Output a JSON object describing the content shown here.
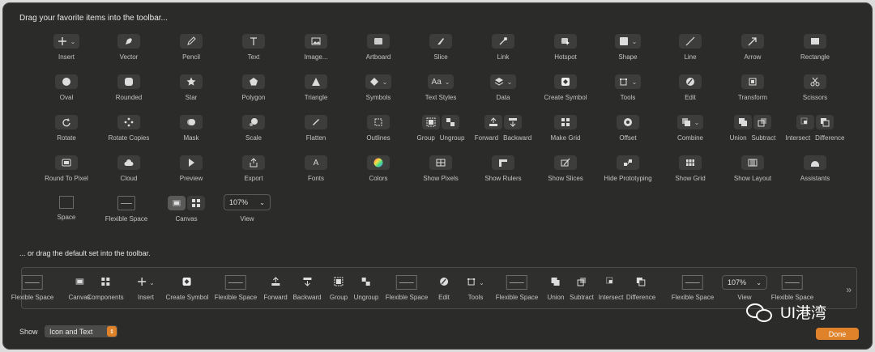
{
  "title": "Drag your favorite items into the toolbar...",
  "rows": [
    [
      {
        "label": "Insert",
        "icon": "plus-icon",
        "chev": true
      },
      {
        "label": "Vector",
        "icon": "pen-icon"
      },
      {
        "label": "Pencil",
        "icon": "pencil-icon"
      },
      {
        "label": "Text",
        "icon": "text-icon"
      },
      {
        "label": "Image...",
        "icon": "image-icon"
      },
      {
        "label": "Artboard",
        "icon": "artboard-icon"
      },
      {
        "label": "Slice",
        "icon": "knife-icon"
      },
      {
        "label": "Link",
        "icon": "link-icon"
      },
      {
        "label": "Hotspot",
        "icon": "hotspot-icon"
      },
      {
        "label": "Shape",
        "icon": "square-icon",
        "chev": true
      },
      {
        "label": "Line",
        "icon": "line-icon"
      },
      {
        "label": "Arrow",
        "icon": "arrow-icon"
      },
      {
        "label": "Rectangle",
        "icon": "rectangle-icon"
      }
    ],
    [
      {
        "label": "Oval",
        "icon": "oval-icon"
      },
      {
        "label": "Rounded",
        "icon": "rounded-square-icon"
      },
      {
        "label": "Star",
        "icon": "star-icon"
      },
      {
        "label": "Polygon",
        "icon": "pentagon-icon"
      },
      {
        "label": "Triangle",
        "icon": "triangle-icon"
      },
      {
        "label": "Symbols",
        "icon": "diamond-icon",
        "chev": true
      },
      {
        "label": "Text Styles",
        "icon": "text-styles-icon",
        "text": "Aa",
        "chev": true
      },
      {
        "label": "Data",
        "icon": "layers-icon",
        "chev": true
      },
      {
        "label": "Create Symbol",
        "icon": "create-symbol-icon"
      },
      {
        "label": "Tools",
        "icon": "tools-icon",
        "chev": true
      },
      {
        "label": "Edit",
        "icon": "edit-icon"
      },
      {
        "label": "Transform",
        "icon": "transform-icon"
      },
      {
        "label": "Scissors",
        "icon": "scissors-icon"
      }
    ],
    [
      {
        "label": "Rotate",
        "icon": "rotate-icon"
      },
      {
        "label": "Rotate Copies",
        "icon": "rotate-copies-icon"
      },
      {
        "label": "Mask",
        "icon": "mask-icon"
      },
      {
        "label": "Scale",
        "icon": "scale-icon"
      },
      {
        "label": "Flatten",
        "icon": "flatten-icon"
      },
      {
        "label": "Outlines",
        "icon": "outlines-icon"
      },
      {
        "label": "Group",
        "label2": "Ungroup",
        "icon": "group-icon",
        "icon2": "ungroup-icon",
        "pair": true
      },
      {
        "label": "Forward",
        "label2": "Backward",
        "icon": "forward-icon",
        "icon2": "backward-icon",
        "pair": true
      },
      {
        "label": "Make Grid",
        "icon": "grid-icon"
      },
      {
        "label": "Offset",
        "icon": "offset-icon"
      },
      {
        "label": "Combine",
        "icon": "combine-icon",
        "chev": true
      },
      {
        "label": "Union",
        "label2": "Subtract",
        "icon": "union-icon",
        "icon2": "subtract-icon",
        "pair": true
      },
      {
        "label": "Intersect",
        "label2": "Difference",
        "icon": "intersect-icon",
        "icon2": "difference-icon",
        "pair": true
      }
    ],
    [
      {
        "label": "Round To Pixel",
        "icon": "round-pixel-icon"
      },
      {
        "label": "Cloud",
        "icon": "cloud-icon"
      },
      {
        "label": "Preview",
        "icon": "play-icon"
      },
      {
        "label": "Export",
        "icon": "export-icon"
      },
      {
        "label": "Fonts",
        "icon": "fonts-icon",
        "text": "A"
      },
      {
        "label": "Colors",
        "icon": "color-wheel-icon"
      },
      {
        "label": "Show Pixels",
        "icon": "pixels-icon"
      },
      {
        "label": "Show Rulers",
        "icon": "rulers-icon"
      },
      {
        "label": "Show Slices",
        "icon": "slices-icon"
      },
      {
        "label": "Hide Prototyping",
        "icon": "prototyping-icon"
      },
      {
        "label": "Show Grid",
        "icon": "show-grid-icon"
      },
      {
        "label": "Show Layout",
        "icon": "layout-icon"
      },
      {
        "label": "Assistants",
        "icon": "assistants-icon"
      }
    ]
  ],
  "row5": {
    "space": "Space",
    "flexible_space": "Flexible Space",
    "canvas": "Canvas",
    "view": "View",
    "view_value": "107%"
  },
  "divider_text": "... or drag the default set into the toolbar.",
  "default_set": [
    {
      "label": "Flexible Space",
      "type": "flex"
    },
    {
      "label": "Canvas",
      "icon": "canvas-icon"
    },
    {
      "label": "Components",
      "icon": "components-icon"
    },
    {
      "label": "Insert",
      "icon": "plus-icon",
      "chev": true
    },
    {
      "label": "Create Symbol",
      "icon": "create-symbol-icon"
    },
    {
      "label": "Flexible Space",
      "type": "flex"
    },
    {
      "label": "Forward",
      "icon": "forward-icon"
    },
    {
      "label": "Backward",
      "icon": "backward-icon"
    },
    {
      "label": "Group",
      "icon": "group-icon"
    },
    {
      "label": "Ungroup",
      "icon": "ungroup-icon"
    },
    {
      "label": "Flexible Space",
      "type": "flex"
    },
    {
      "label": "Edit",
      "icon": "edit-icon"
    },
    {
      "label": "Tools",
      "icon": "tools-icon",
      "chev": true
    },
    {
      "label": "Flexible Space",
      "type": "flex"
    },
    {
      "label": "Union",
      "icon": "union-icon"
    },
    {
      "label": "Subtract",
      "icon": "subtract-icon"
    },
    {
      "label": "Intersect",
      "icon": "intersect-icon"
    },
    {
      "label": "Difference",
      "icon": "difference-icon"
    },
    {
      "label": "Flexible Space",
      "type": "flex"
    },
    {
      "label": "View",
      "type": "view",
      "value": "107%"
    },
    {
      "label": "Flexible Space",
      "type": "flex"
    }
  ],
  "show_label": "Show",
  "show_value": "Icon and Text",
  "done_label": "Done",
  "watermark": "UI港湾",
  "colors": {
    "accent": "#e0822a",
    "panel": "#2b2b2a",
    "button": "#3d3d3b"
  }
}
